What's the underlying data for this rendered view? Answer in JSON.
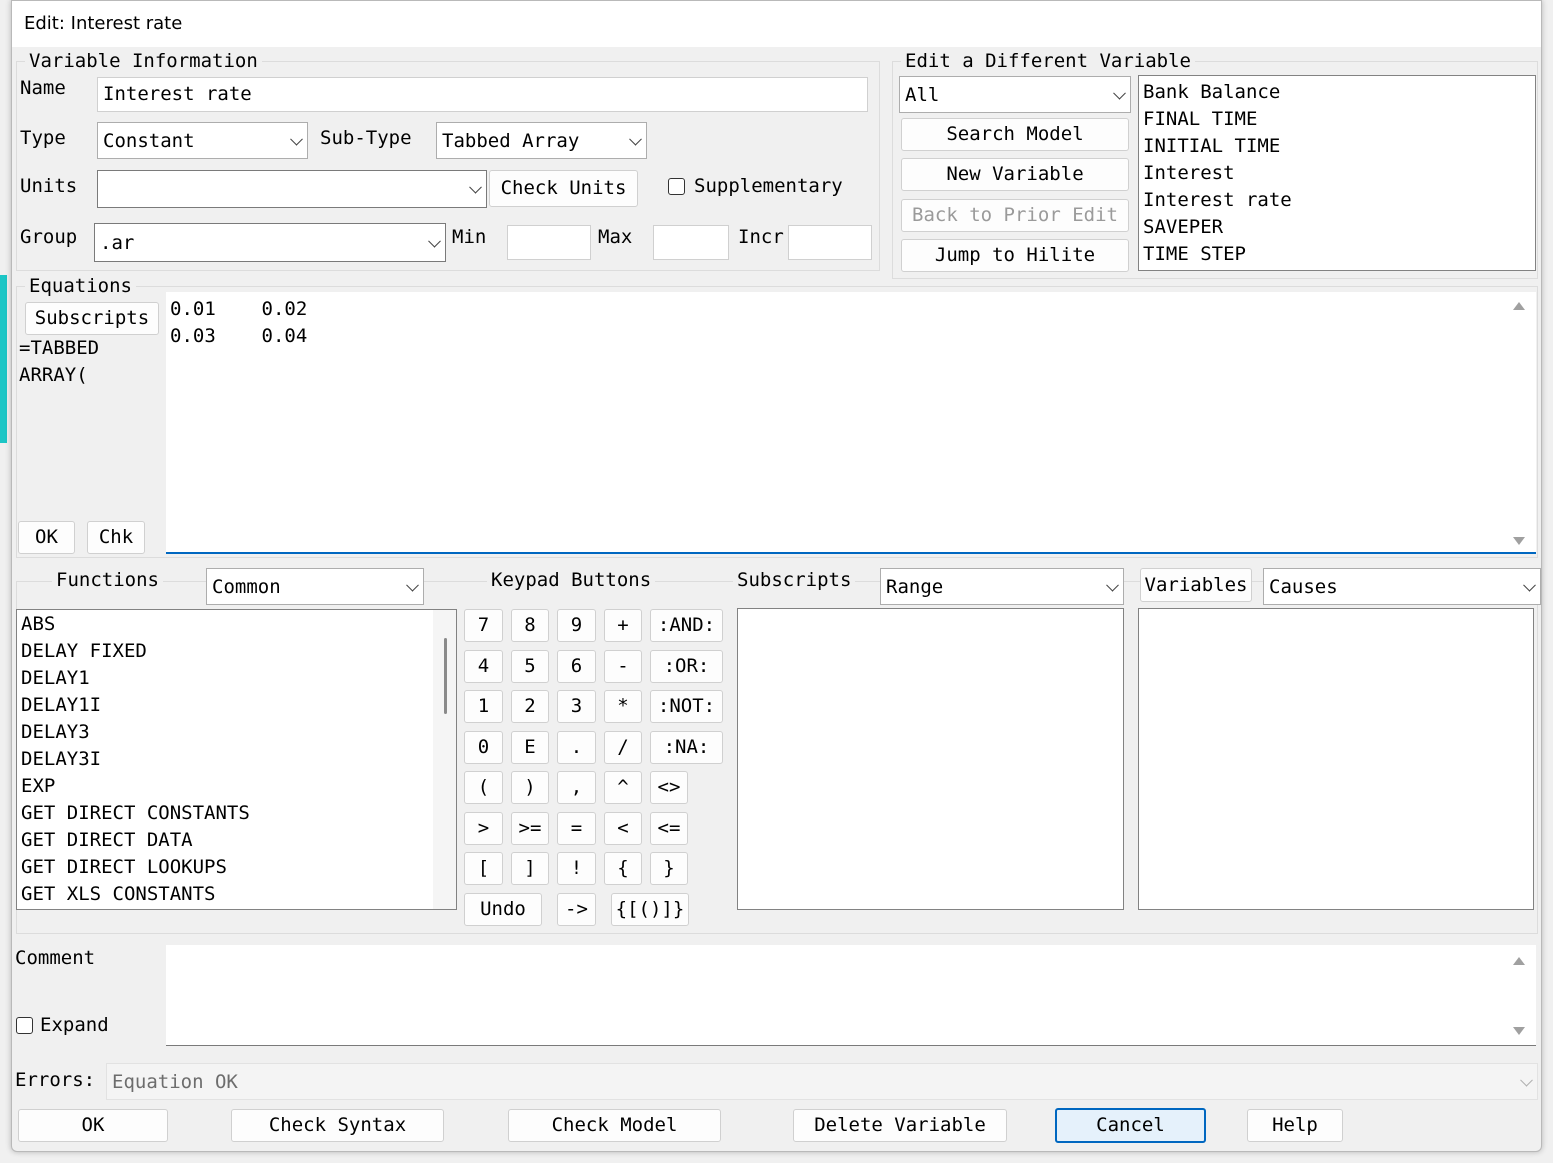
{
  "window": {
    "title": "Edit: Interest rate"
  },
  "variable_info": {
    "legend": "Variable Information",
    "name_label": "Name",
    "name_value": "Interest rate",
    "type_label": "Type",
    "type_value": "Constant",
    "subtype_label": "Sub-Type",
    "subtype_value": "Tabbed Array",
    "units_label": "Units",
    "units_value": "",
    "check_units": "Check Units",
    "supplementary": "Supplementary",
    "group_label": "Group",
    "group_value": ".ar",
    "min_label": "Min",
    "max_label": "Max",
    "incr_label": "Incr"
  },
  "edit_different": {
    "legend": "Edit a Different Variable",
    "filter_value": "All",
    "search_model": "Search Model",
    "new_variable": "New Variable",
    "back_to_prior": "Back to Prior Edit",
    "jump_to_hilite": "Jump to Hilite",
    "variables": [
      "Bank Balance",
      "FINAL TIME",
      "INITIAL TIME",
      "Interest",
      "Interest rate",
      "SAVEPER",
      "TIME STEP"
    ]
  },
  "equations": {
    "legend": "Equations",
    "subscripts_button": "Subscripts",
    "prefix_line1": "=TABBED",
    "prefix_line2": "ARRAY(",
    "row1": "0.01    0.02",
    "row2": "0.03    0.04",
    "ok": "OK",
    "chk": "Chk"
  },
  "functions": {
    "label": "Functions",
    "filter_value": "Common",
    "items": [
      "ABS",
      "DELAY FIXED",
      "DELAY1",
      "DELAY1I",
      "DELAY3",
      "DELAY3I",
      "EXP",
      "GET DIRECT CONSTANTS",
      "GET DIRECT DATA",
      "GET DIRECT LOOKUPS",
      "GET XLS CONSTANTS"
    ]
  },
  "keypad": {
    "label": "Keypad Buttons",
    "rows": [
      [
        "7",
        "8",
        "9",
        "+",
        ":AND:"
      ],
      [
        "4",
        "5",
        "6",
        "-",
        ":OR:"
      ],
      [
        "1",
        "2",
        "3",
        "*",
        ":NOT:"
      ],
      [
        "0",
        "E",
        ".",
        "/",
        ":NA:"
      ],
      [
        "(",
        ")",
        ",",
        "^",
        "<>"
      ],
      [
        ">",
        ">=",
        "=",
        "<",
        "<="
      ],
      [
        "[",
        "]",
        "!",
        "{",
        "}"
      ]
    ],
    "undo": "Undo",
    "arrow": "->",
    "brackets": "{[()]}"
  },
  "subscripts_panel": {
    "label": "Subscripts",
    "filter_value": "Range"
  },
  "variables_panel": {
    "label": "Variables",
    "filter_value": "Causes"
  },
  "comment": {
    "label": "Comment",
    "expand": "Expand"
  },
  "errors": {
    "label": "Errors:",
    "value": "Equation OK"
  },
  "footer": {
    "ok": "OK",
    "check_syntax": "Check Syntax",
    "check_model": "Check Model",
    "delete_variable": "Delete Variable",
    "cancel": "Cancel",
    "help": "Help"
  }
}
